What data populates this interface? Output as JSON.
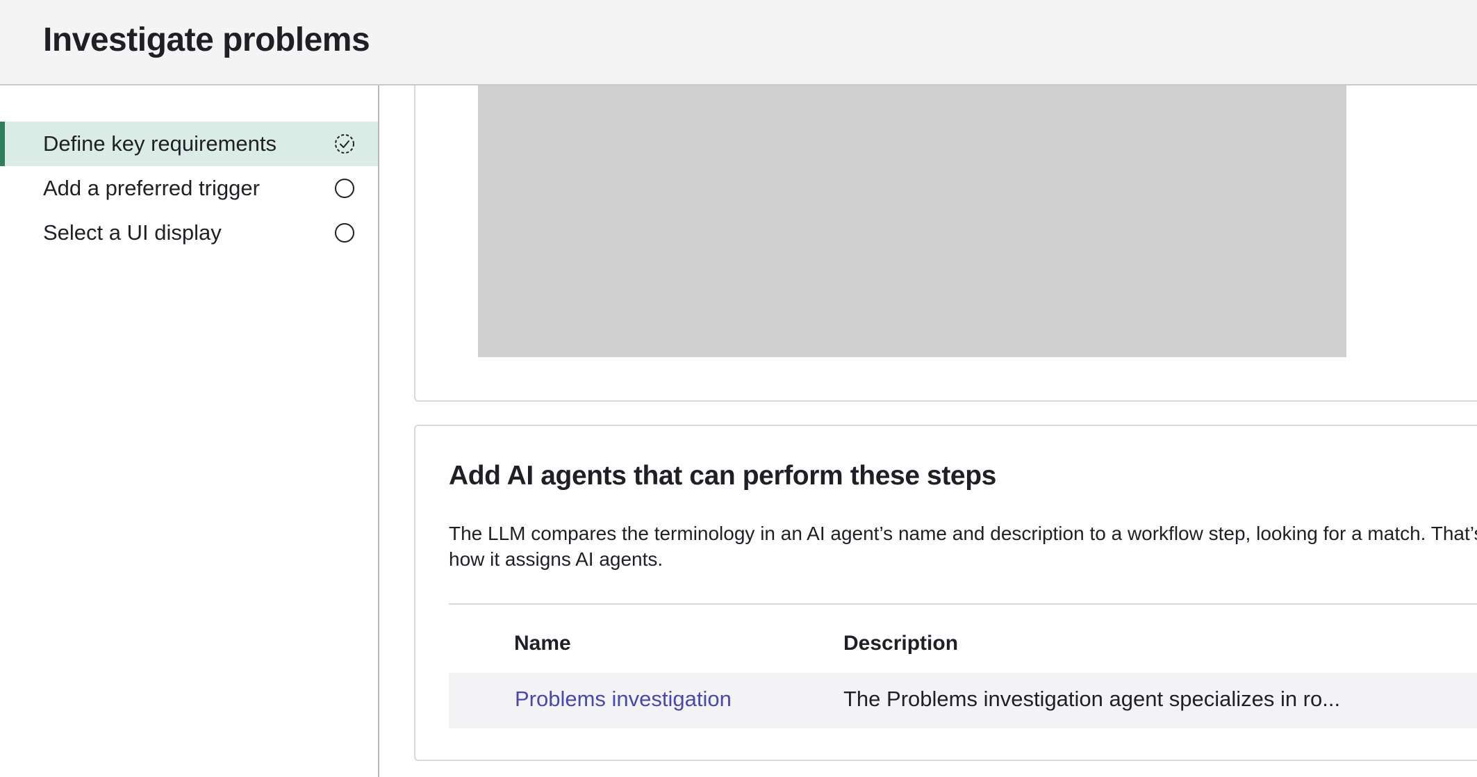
{
  "header": {
    "title": "Investigate problems"
  },
  "sidebar": {
    "steps": [
      {
        "label": "Define key requirements",
        "status": "in-progress",
        "icon": "dashed-check-circle-icon",
        "active": true
      },
      {
        "label": "Add a preferred trigger",
        "status": "not-started",
        "icon": "empty-circle-icon",
        "active": false
      },
      {
        "label": "Select a UI display",
        "status": "not-started",
        "icon": "empty-circle-icon",
        "active": false
      }
    ]
  },
  "agents_card": {
    "title": "Add AI agents that can perform these steps",
    "description": "The LLM compares the terminology in an AI agent’s name and description to a workflow step, looking for a match. That’s how it assigns AI agents.",
    "columns": [
      "Name",
      "Description"
    ],
    "rows": [
      {
        "name": "Problems investigation",
        "description": "The Problems investigation agent specializes in ro..."
      }
    ]
  },
  "colors": {
    "accent": "#2e7d5b",
    "active_bg": "#dbebe5",
    "link": "#4a47b5",
    "placeholder": "#cfcfcf"
  }
}
